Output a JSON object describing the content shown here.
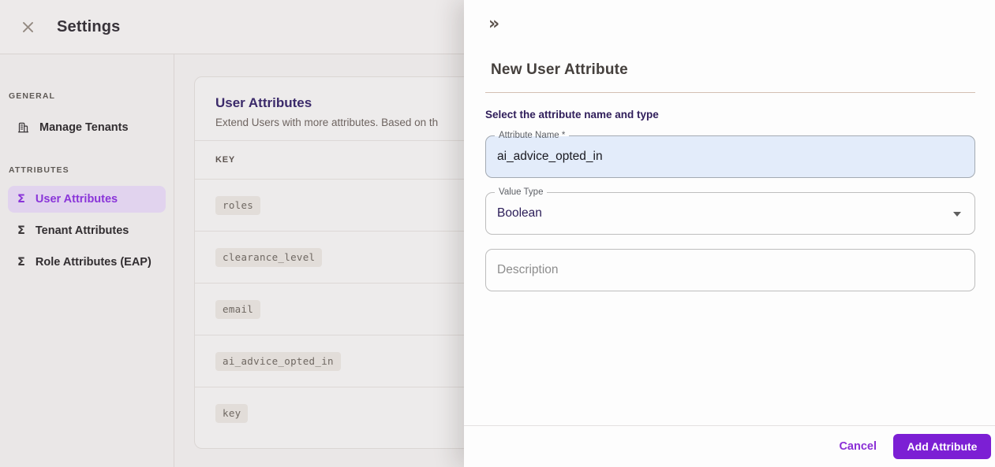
{
  "header": {
    "title": "Settings"
  },
  "sidebar": {
    "sections": [
      {
        "label": "GENERAL",
        "items": [
          {
            "label": "Manage Tenants",
            "icon": "building-icon",
            "selected": false
          }
        ]
      },
      {
        "label": "ATTRIBUTES",
        "items": [
          {
            "label": "User Attributes",
            "icon": "sigma-icon",
            "selected": true
          },
          {
            "label": "Tenant Attributes",
            "icon": "sigma-icon",
            "selected": false
          },
          {
            "label": "Role Attributes (EAP)",
            "icon": "sigma-icon",
            "selected": false
          }
        ]
      }
    ],
    "sigma_glyph": "Σ"
  },
  "main": {
    "title": "User Attributes",
    "subtitle": "Extend Users with more attributes. Based on th",
    "table": {
      "columns": [
        "KEY"
      ],
      "rows": [
        "roles",
        "clearance_level",
        "email",
        "ai_advice_opted_in",
        "key"
      ]
    }
  },
  "drawer": {
    "collapse_glyph": "»",
    "title": "New User Attribute",
    "section_label": "Select the attribute name and type",
    "fields": {
      "attribute_name": {
        "label": "Attribute Name *",
        "value": "ai_advice_opted_in"
      },
      "value_type": {
        "label": "Value Type",
        "value": "Boolean"
      },
      "description": {
        "placeholder": "Description"
      }
    },
    "footer": {
      "cancel_label": "Cancel",
      "submit_label": "Add Attribute"
    }
  },
  "colors": {
    "accent_purple": "#7c1fd4",
    "selected_item_bg": "#e1d3ee",
    "selected_item_text": "#8a35d9",
    "autofill_field_bg": "#e3ecfa",
    "heading_purple": "#3b2a6a",
    "divider_tan": "#d3bfb2"
  }
}
